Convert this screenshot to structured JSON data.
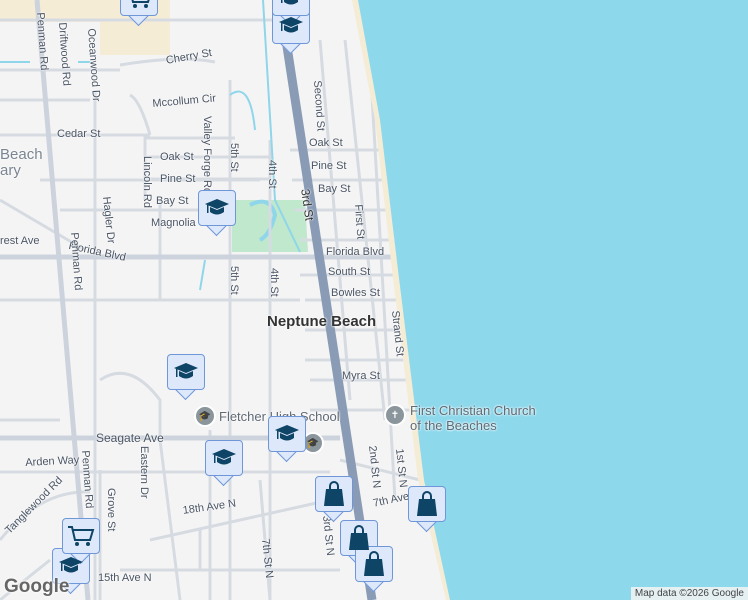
{
  "map": {
    "city_label": "Neptune Beach",
    "attribution": "Map data ©2026 Google",
    "logo": "Google",
    "colors": {
      "ocean": "#8ed8ec",
      "land": "#f5f4f5",
      "road": "#d6dbe2",
      "highway": "#8a9bb5",
      "park": "#bfe8cc",
      "sand": "#f5ecd6",
      "marker_bg": "#dde8fb",
      "marker_icon": "#0e4466"
    },
    "streets": {
      "penman_n": "Penman Rd",
      "penman_s": "Penman Rd",
      "penman_s2": "Penman Rd",
      "driftwood": "Driftwood Rd",
      "oceanwood": "Oceanwood Dr",
      "cherry": "Cherry St",
      "mccollum": "Mccollum Cir",
      "cedar": "Cedar St",
      "valley_forge": "Valley Forge Rd",
      "fifth_n": "5th St",
      "fourth_n": "4th St",
      "fifth_s": "5th St",
      "fourth_s": "4th St",
      "lincoln": "Lincoln Rd",
      "oak_w": "Oak St",
      "pine_w": "Pine St",
      "bay_w": "Bay St",
      "magnolia": "Magnolia",
      "hagler": "Hagler Dr",
      "forest": "rest Ave",
      "florida_w": "Florida Blvd",
      "florida_e": "Florida Blvd",
      "second": "Second St",
      "oak_e": "Oak St",
      "pine_e": "Pine St",
      "bay_e": "Bay St",
      "third": "3rd St",
      "first": "First St",
      "south": "South St",
      "bowles": "Bowles St",
      "strand": "Strand St",
      "myra": "Myra St",
      "seagate": "Seagate Ave",
      "arden": "Arden Way",
      "tanglewood": "Tanglewood Rd",
      "grove": "Grove St",
      "eastern": "Eastern Dr",
      "eighteenth": "18th Ave N",
      "fifteenth": "15th Ave N",
      "seventh": "7th St N",
      "second_n": "2nd St N",
      "first_n": "1st St N",
      "third_n": "3rd St N",
      "seventeenth": "7th Ave",
      "library": "Beach",
      "library2": "ary"
    },
    "pois": {
      "fletcher": "Fletcher High School",
      "church_1": "First Christian Church",
      "church_2": "of the Beaches"
    },
    "markers": [
      "school",
      "school",
      "school",
      "school",
      "school",
      "school",
      "shopping",
      "shopping",
      "shopping",
      "shopping",
      "grocery",
      "school",
      "grocery"
    ]
  }
}
